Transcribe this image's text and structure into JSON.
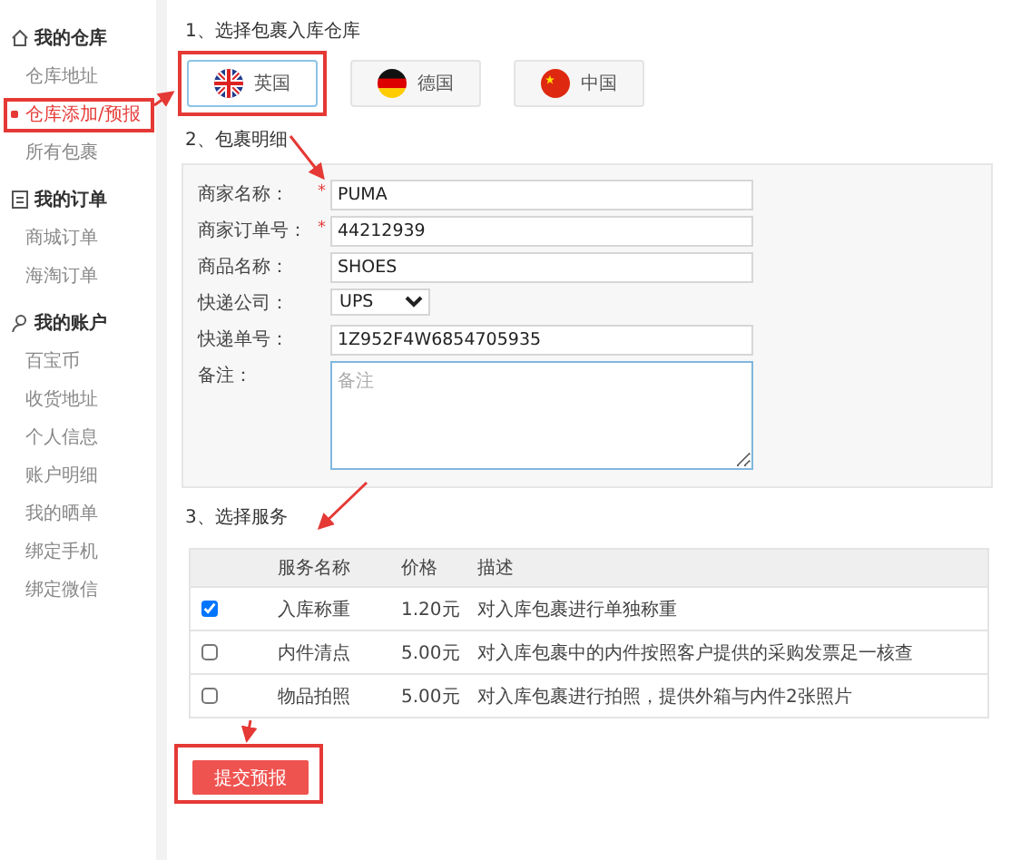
{
  "sidebar": {
    "groups": [
      {
        "title": "我的仓库",
        "items": [
          {
            "label": "仓库地址",
            "selected": false
          },
          {
            "label": "仓库添加/预报",
            "selected": true,
            "highlighted": true
          },
          {
            "label": "所有包裹",
            "selected": false
          }
        ]
      },
      {
        "title": "我的订单",
        "items": [
          {
            "label": "商城订单",
            "selected": false
          },
          {
            "label": "海淘订单",
            "selected": false
          }
        ]
      },
      {
        "title": "我的账户",
        "items": [
          {
            "label": "百宝币",
            "selected": false
          },
          {
            "label": "收货地址",
            "selected": false
          },
          {
            "label": "个人信息",
            "selected": false
          },
          {
            "label": "账户明细",
            "selected": false
          },
          {
            "label": "我的晒单",
            "selected": false
          },
          {
            "label": "绑定手机",
            "selected": false
          },
          {
            "label": "绑定微信",
            "selected": false
          }
        ]
      }
    ]
  },
  "step1": {
    "title": "1、选择包裹入库仓库",
    "warehouses": [
      {
        "label": "英国",
        "selected": true,
        "highlighted": true
      },
      {
        "label": "德国",
        "selected": false,
        "highlighted": false
      },
      {
        "label": "中国",
        "selected": false,
        "highlighted": false
      }
    ]
  },
  "step2": {
    "title": "2、包裹明细",
    "required_symbol": "*",
    "fields": [
      {
        "kind": "text",
        "label": "商家名称：",
        "required": true,
        "value": "PUMA"
      },
      {
        "kind": "text",
        "label": "商家订单号：",
        "required": true,
        "value": "44212939"
      },
      {
        "kind": "text",
        "label": "商品名称：",
        "required": false,
        "value": "SHOES"
      },
      {
        "kind": "select",
        "label": "快递公司：",
        "required": false,
        "value": "UPS"
      },
      {
        "kind": "text",
        "label": "快递单号：",
        "required": false,
        "value": "1Z952F4W6854705935"
      },
      {
        "kind": "textarea",
        "label": "备注：",
        "required": false,
        "placeholder": "备注"
      }
    ]
  },
  "step3": {
    "title": "3、选择服务",
    "columns": [
      "服务名称",
      "价格",
      "描述"
    ],
    "rows": [
      {
        "checked": true,
        "name": "入库称重",
        "price": "1.20元",
        "description": "对入库包裹进行单独称重"
      },
      {
        "checked": false,
        "name": "内件清点",
        "price": "5.00元",
        "description": "对入库包裹中的内件按照客户提供的采购发票足一核查"
      },
      {
        "checked": false,
        "name": "物品拍照",
        "price": "5.00元",
        "description": "对入库包裹进行拍照，提供外箱与内件2张照片"
      }
    ]
  },
  "submit": {
    "label": "提交预报",
    "highlighted": true
  }
}
